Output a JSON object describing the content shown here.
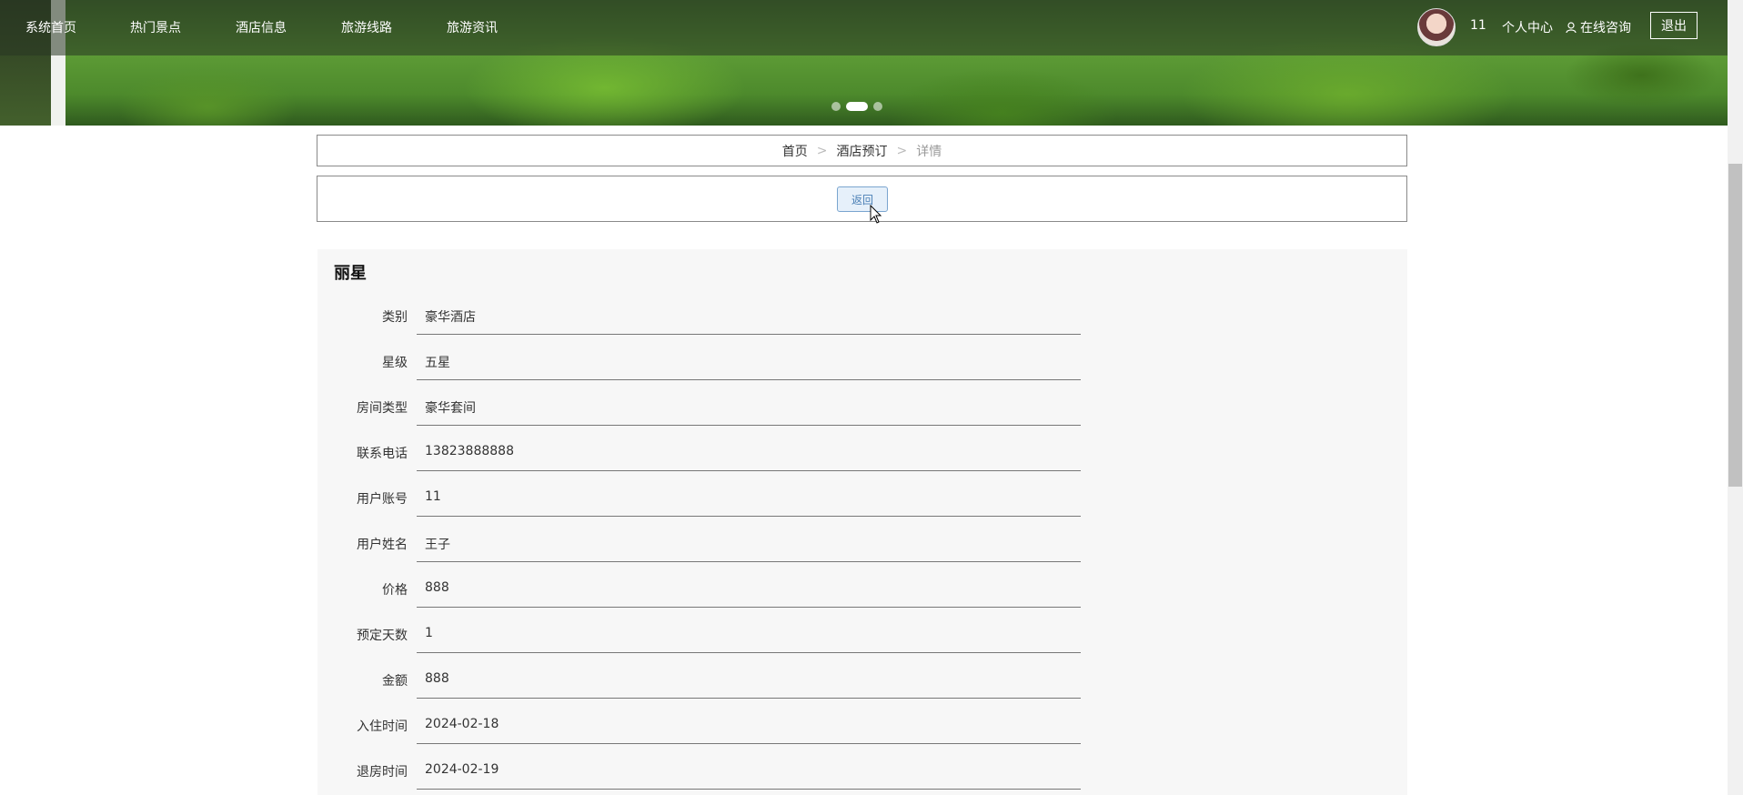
{
  "nav": {
    "items": [
      "系统首页",
      "热门景点",
      "酒店信息",
      "旅游线路",
      "旅游资讯"
    ],
    "username": "11",
    "personal_center": "个人中心",
    "consult": "在线咨询",
    "logout": "退出"
  },
  "breadcrumb": {
    "home": "首页",
    "section": "酒店预订",
    "current": "详情",
    "separator": ">"
  },
  "back_button": "返回",
  "detail": {
    "title": "丽星",
    "fields": [
      {
        "label": "类别",
        "value": "豪华酒店"
      },
      {
        "label": "星级",
        "value": "五星"
      },
      {
        "label": "房间类型",
        "value": "豪华套间"
      },
      {
        "label": "联系电话",
        "value": "13823888888"
      },
      {
        "label": "用户账号",
        "value": "11"
      },
      {
        "label": "用户姓名",
        "value": "王子"
      },
      {
        "label": "价格",
        "value": "888"
      },
      {
        "label": "预定天数",
        "value": "1"
      },
      {
        "label": "金额",
        "value": "888"
      },
      {
        "label": "入住时间",
        "value": "2024-02-18"
      },
      {
        "label": "退房时间",
        "value": "2024-02-19"
      }
    ]
  }
}
